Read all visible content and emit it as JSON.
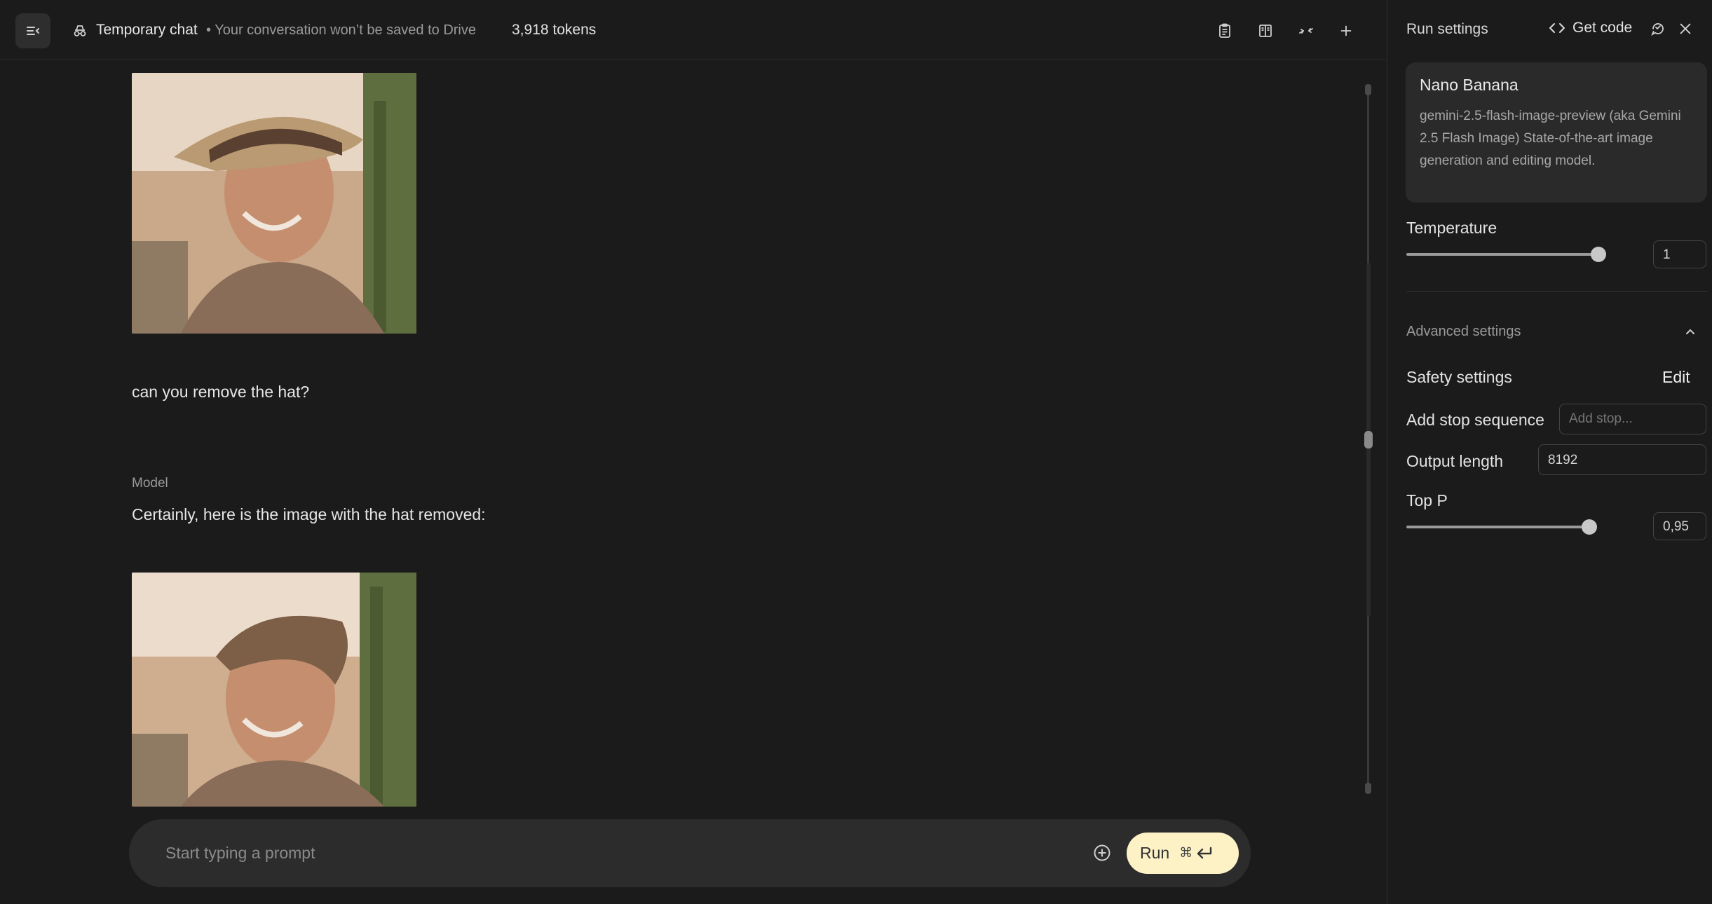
{
  "header": {
    "chat_title": "Temporary chat",
    "chat_subtitle": "• Your conversation won’t be saved to Drive",
    "tokens": "3,918 tokens"
  },
  "conversation": {
    "user_message": "can you remove the hat?",
    "model_role": "Model",
    "model_message": "Certainly, here is the image with the hat removed:"
  },
  "prompt": {
    "placeholder": "Start typing a prompt",
    "run_label": "Run",
    "shortcut": "⌘"
  },
  "run_settings": {
    "title": "Run settings",
    "get_code_label": "Get code",
    "model": {
      "name": "Nano Banana",
      "description": "gemini-2.5-flash-image-preview (aka Gemini 2.5 Flash Image) State-of-the-art image generation and editing model."
    },
    "temperature": {
      "label": "Temperature",
      "value": "1",
      "fraction": 1.0
    },
    "advanced_label": "Advanced settings",
    "safety": {
      "label": "Safety settings",
      "action": "Edit"
    },
    "stop_sequence": {
      "label": "Add stop sequence",
      "placeholder": "Add stop..."
    },
    "output_length": {
      "label": "Output length",
      "value": "8192"
    },
    "top_p": {
      "label": "Top P",
      "value": "0,95",
      "fraction": 0.95
    }
  }
}
